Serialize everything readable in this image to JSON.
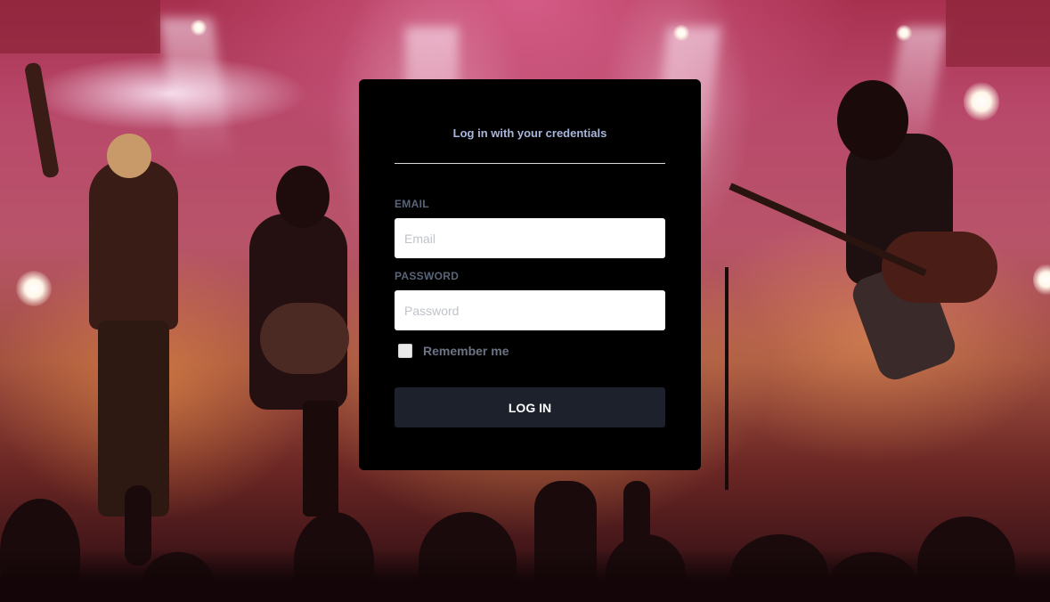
{
  "background": {
    "description_icon": "concert-stage-photo"
  },
  "login": {
    "title": "Log in with your credentials",
    "email": {
      "label": "EMAIL",
      "placeholder": "Email",
      "value": ""
    },
    "password": {
      "label": "PASSWORD",
      "placeholder": "Password",
      "value": ""
    },
    "remember": {
      "label": "Remember me",
      "checked": false
    },
    "submit_label": "LOG IN"
  },
  "colors": {
    "card_bg": "#000000",
    "title": "#a9b6dc",
    "label": "#5a6478",
    "button_bg": "#1c212b",
    "button_text": "#ffffff"
  }
}
